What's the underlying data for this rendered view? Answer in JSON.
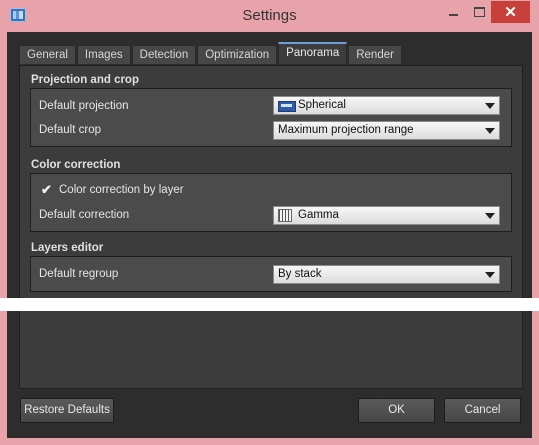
{
  "window": {
    "title": "Settings"
  },
  "tabs": [
    {
      "label": "General"
    },
    {
      "label": "Images"
    },
    {
      "label": "Detection"
    },
    {
      "label": "Optimization"
    },
    {
      "label": "Panorama",
      "active": true
    },
    {
      "label": "Render"
    }
  ],
  "sections": {
    "projection": {
      "title": "Projection and crop",
      "default_projection_label": "Default projection",
      "default_projection_value": "Spherical",
      "default_crop_label": "Default crop",
      "default_crop_value": "Maximum projection range"
    },
    "color": {
      "title": "Color correction",
      "checkbox_label": "Color correction by layer",
      "checkbox_checked": true,
      "default_correction_label": "Default correction",
      "default_correction_value": "Gamma"
    },
    "layers": {
      "title": "Layers editor",
      "default_regroup_label": "Default regroup",
      "default_regroup_value": "By stack"
    }
  },
  "buttons": {
    "restore": "Restore Defaults",
    "ok": "OK",
    "cancel": "Cancel"
  },
  "icons": {
    "app": "app-icon",
    "minimize": "minimize-icon",
    "maximize": "maximize-icon",
    "close": "close-icon",
    "projection": "spherical-projection-icon",
    "gamma": "gamma-curve-icon"
  },
  "colors": {
    "titlebar": "#e8a3aa",
    "close_button": "#c7413a",
    "panel": "#3c3c3c",
    "group": "#4b4b4b",
    "active_tab_accent": "#6d9fd6"
  }
}
